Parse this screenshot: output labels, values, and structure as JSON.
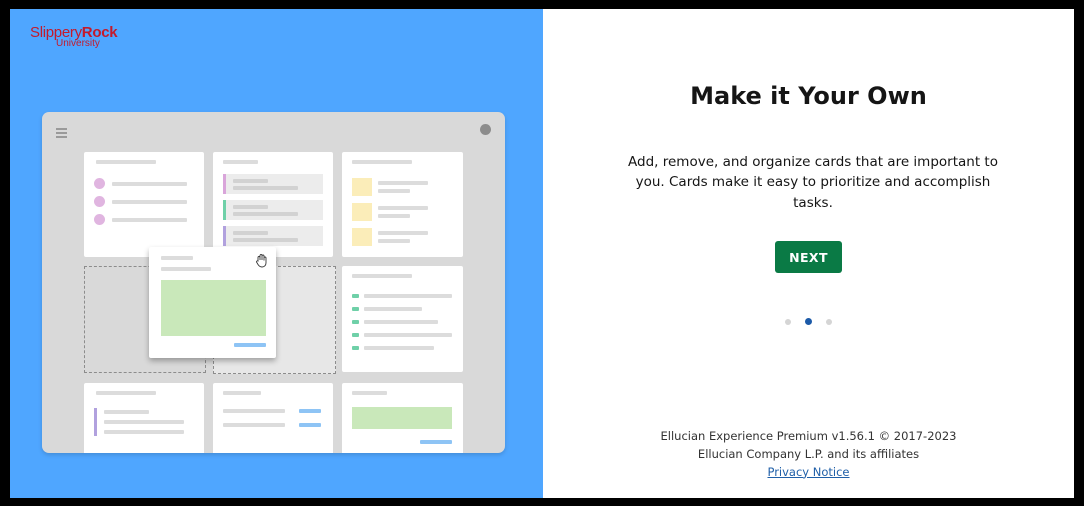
{
  "logo": {
    "line1_regular": "Slippery",
    "line1_bold": "Rock",
    "line2": "University"
  },
  "illustration": {
    "menu_icon": "hamburger-menu-icon",
    "avatar_icon": "user-avatar-icon",
    "drag_icon": "grab-hand-icon"
  },
  "onboarding": {
    "title": "Make it Your Own",
    "description": "Add, remove, and organize cards that are important to you. Cards make it easy to prioritize and accomplish tasks.",
    "next_label": "NEXT",
    "page_indicator": {
      "total": 3,
      "active_index": 1
    }
  },
  "footer": {
    "version_line": "Ellucian Experience Premium v1.56.1 © 2017-2023",
    "company_line": "Ellucian Company L.P. and its affiliates",
    "privacy_link": "Privacy Notice"
  },
  "colors": {
    "left_panel": "#4fa6ff",
    "next_button": "#0a7a45",
    "active_dot": "#1c5aa8",
    "logo_red": "#c41a2b",
    "link": "#1f5fa8"
  }
}
